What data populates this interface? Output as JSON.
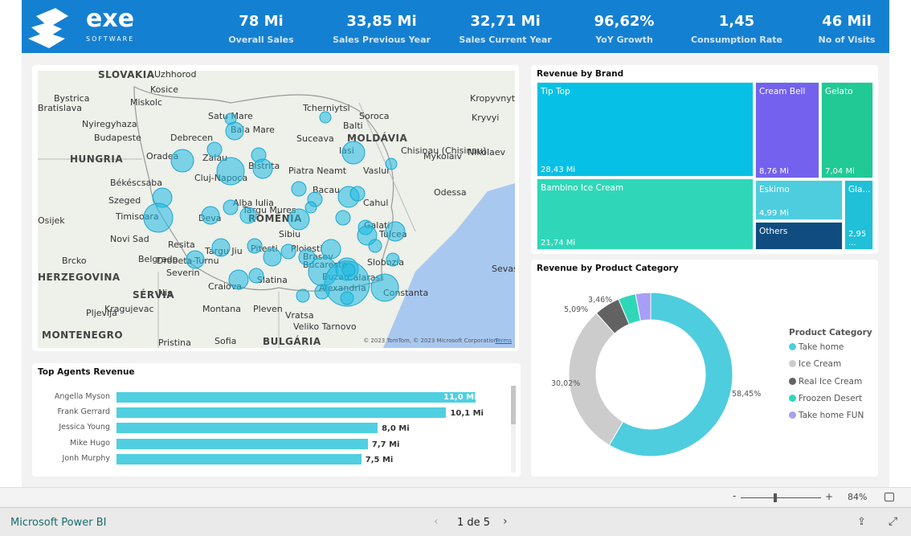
{
  "brand": {
    "name": "exe",
    "sub": "SOFTWARE"
  },
  "kpis": [
    {
      "value": "78 Mi",
      "label": "Overall Sales"
    },
    {
      "value": "33,85 Mi",
      "label": "Sales Previous Year"
    },
    {
      "value": "32,71 Mi",
      "label": "Sales Current Year"
    },
    {
      "value": "96,62%",
      "label": "YoY Growth"
    },
    {
      "value": "1,45",
      "label": "Consumption Rate"
    },
    {
      "value": "46 Mil",
      "label": "No of Visits"
    }
  ],
  "map": {
    "labels": [
      "SLOVAKIA",
      "Bratislava",
      "Bystrica",
      "Miskolc",
      "Kosice",
      "Uzhhorod",
      "Nyiregyhaza",
      "Budapeste",
      "HUNGRIA",
      "Debrecen",
      "Békéscsaba",
      "Szeged",
      "Novi Sad",
      "Belgrado",
      "SÉRVIA",
      "HERZEGOVINA",
      "MONTENEGRO",
      "Pristina",
      "Oradea",
      "Cluj-Napoca",
      "Satu Mare",
      "Baia Mare",
      "Suceava",
      "Iasi",
      "MOLDÁVIA",
      "Chisinau (Chisinau)",
      "Nikolaev",
      "Odessa",
      "Tcherniytsi",
      "Soroca",
      "Balti",
      "Kropyvnytskyi",
      "Kryvyi",
      "Piatra Neamt",
      "Vaslui",
      "Bacau",
      "Targu Mures",
      "Bistrita",
      "Zalau",
      "Alba Iulia",
      "ROMÊNIA",
      "Timisoara",
      "Deva",
      "Resita",
      "Sibiu",
      "Brasov",
      "Galati",
      "Tulcea",
      "Cahul",
      "Buzau",
      "Pitesti",
      "Ploiesti",
      "Targu Jiu",
      "Drobeta-Turnu",
      "Severin",
      "Craiova",
      "Slatina",
      "Bucareste",
      "Alexandria",
      "Slobozia",
      "Calarasi",
      "Constanta",
      "Montana",
      "Pleven",
      "Vratsa",
      "Veliko Tarnovo",
      "Sofia",
      "BULGÁRIA",
      "Kragujevac",
      "Nis",
      "Pljevlja",
      "Osijek",
      "Brcko",
      "Sevast",
      "Mykolaiv"
    ],
    "attribution": "© 2023 TomTom, © 2023 Microsoft Corporation",
    "terms": "Terms"
  },
  "agents": {
    "title": "Top Agents Revenue",
    "rows": [
      {
        "name": "Angella Myson",
        "value": 11.0,
        "label": "11,0 Mi"
      },
      {
        "name": "Frank Gerrard",
        "value": 10.1,
        "label": "10,1 Mi"
      },
      {
        "name": "Jessica Young",
        "value": 8.0,
        "label": "8,0 Mi"
      },
      {
        "name": "Mike Hugo",
        "value": 7.7,
        "label": "7,7 Mi"
      },
      {
        "name": "Jonh Murphy",
        "value": 7.5,
        "label": "7,5 Mi"
      }
    ]
  },
  "treemap": {
    "title": "Revenue by Brand",
    "items": [
      {
        "name": "Tip Top",
        "value": "28,43 Mi",
        "color": "#07c0e5"
      },
      {
        "name": "Cream Bell",
        "value": "8,76 Mi",
        "color": "#7461ee"
      },
      {
        "name": "Gelato",
        "value": "7,04 Mi",
        "color": "#21c994"
      },
      {
        "name": "Bambino Ice Cream",
        "value": "21,74 Mi",
        "color": "#2fd7b8"
      },
      {
        "name": "Eskimo",
        "value": "4,99 Mi",
        "color": "#4ecdde"
      },
      {
        "name": "Others",
        "value": "",
        "color": "#104c80"
      },
      {
        "name": "Gla...",
        "value": "2,95 ...",
        "color": "#1fc0d8"
      }
    ]
  },
  "donut": {
    "title": "Revenue by Product Category",
    "legend_title": "Product Category",
    "slices": [
      {
        "name": "Take home",
        "pct": 58.45,
        "label": "58,45%",
        "color": "#4ecdde"
      },
      {
        "name": "Ice Cream",
        "pct": 30.02,
        "label": "30,02%",
        "color": "#cccccc"
      },
      {
        "name": "Real Ice Cream",
        "pct": 5.09,
        "label": "5,09%",
        "color": "#626262"
      },
      {
        "name": "Froozen Desert",
        "pct": 3.46,
        "label": "3,46%",
        "color": "#2fd7b8"
      },
      {
        "name": "Take home FUN",
        "pct": 2.98,
        "label": "",
        "color": "#a99ef5"
      }
    ]
  },
  "zoom": {
    "minus": "-",
    "plus": "+",
    "level": "84%",
    "percent": 84
  },
  "footer": {
    "link": "Microsoft Power BI",
    "page": "1 de 5"
  }
}
